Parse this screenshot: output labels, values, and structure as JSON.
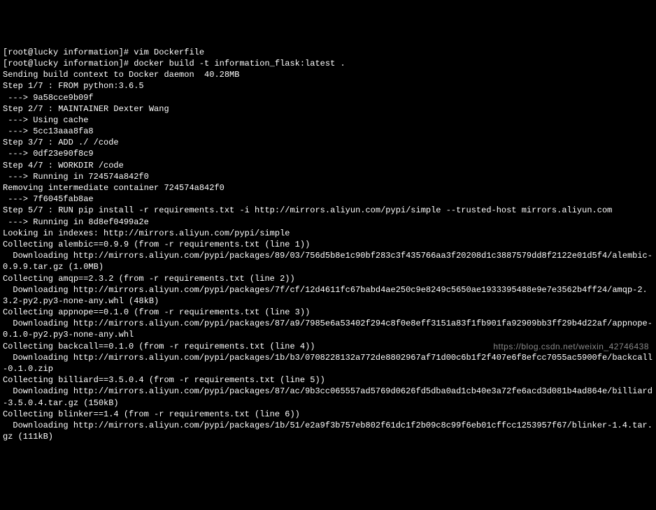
{
  "lines": [
    "[root@lucky information]# vim Dockerfile",
    "[root@lucky information]# docker build -t information_flask:latest .",
    "Sending build context to Docker daemon  40.28MB",
    "Step 1/7 : FROM python:3.6.5",
    " ---> 9a58cce9b09f",
    "Step 2/7 : MAINTAINER Dexter Wang",
    " ---> Using cache",
    " ---> 5cc13aaa8fa8",
    "Step 3/7 : ADD ./ /code",
    " ---> 0df23e90f8c9",
    "Step 4/7 : WORKDIR /code",
    " ---> Running in 724574a842f0",
    "Removing intermediate container 724574a842f0",
    " ---> 7f6045fab8ae",
    "Step 5/7 : RUN pip install -r requirements.txt -i http://mirrors.aliyun.com/pypi/simple --trusted-host mirrors.aliyun.com",
    " ---> Running in 8d8ef0499a2e",
    "Looking in indexes: http://mirrors.aliyun.com/pypi/simple",
    "Collecting alembic==0.9.9 (from -r requirements.txt (line 1))",
    "  Downloading http://mirrors.aliyun.com/pypi/packages/89/03/756d5b8e1c90bf283c3f435766aa3f20208d1c3887579dd8f2122e01d5f4/alembic-0.9.9.tar.gz (1.0MB)",
    "Collecting amqp==2.3.2 (from -r requirements.txt (line 2))",
    "  Downloading http://mirrors.aliyun.com/pypi/packages/7f/cf/12d4611fc67babd4ae250c9e8249c5650ae1933395488e9e7e3562b4ff24/amqp-2.3.2-py2.py3-none-any.whl (48kB)",
    "Collecting appnope==0.1.0 (from -r requirements.txt (line 3))",
    "  Downloading http://mirrors.aliyun.com/pypi/packages/87/a9/7985e6a53402f294c8f0e8eff3151a83f1fb901fa92909bb3ff29b4d22af/appnope-0.1.0-py2.py3-none-any.whl",
    "Collecting backcall==0.1.0 (from -r requirements.txt (line 4))",
    "  Downloading http://mirrors.aliyun.com/pypi/packages/1b/b3/0708228132a772de8802967af71d00c6b1f2f407e6f8efcc7055ac5900fe/backcall-0.1.0.zip",
    "Collecting billiard==3.5.0.4 (from -r requirements.txt (line 5))",
    "  Downloading http://mirrors.aliyun.com/pypi/packages/87/ac/9b3cc065557ad5769d0626fd5dba0ad1cb40e3a72fe6acd3d081b4ad864e/billiard-3.5.0.4.tar.gz (150kB)",
    "Collecting blinker==1.4 (from -r requirements.txt (line 6))",
    "  Downloading http://mirrors.aliyun.com/pypi/packages/1b/51/e2a9f3b757eb802f61dc1f2b09c8c99f6eb01cffcc1253957f67/blinker-1.4.tar.gz (111kB)"
  ],
  "watermark": "https://blog.csdn.net/weixin_42746438"
}
